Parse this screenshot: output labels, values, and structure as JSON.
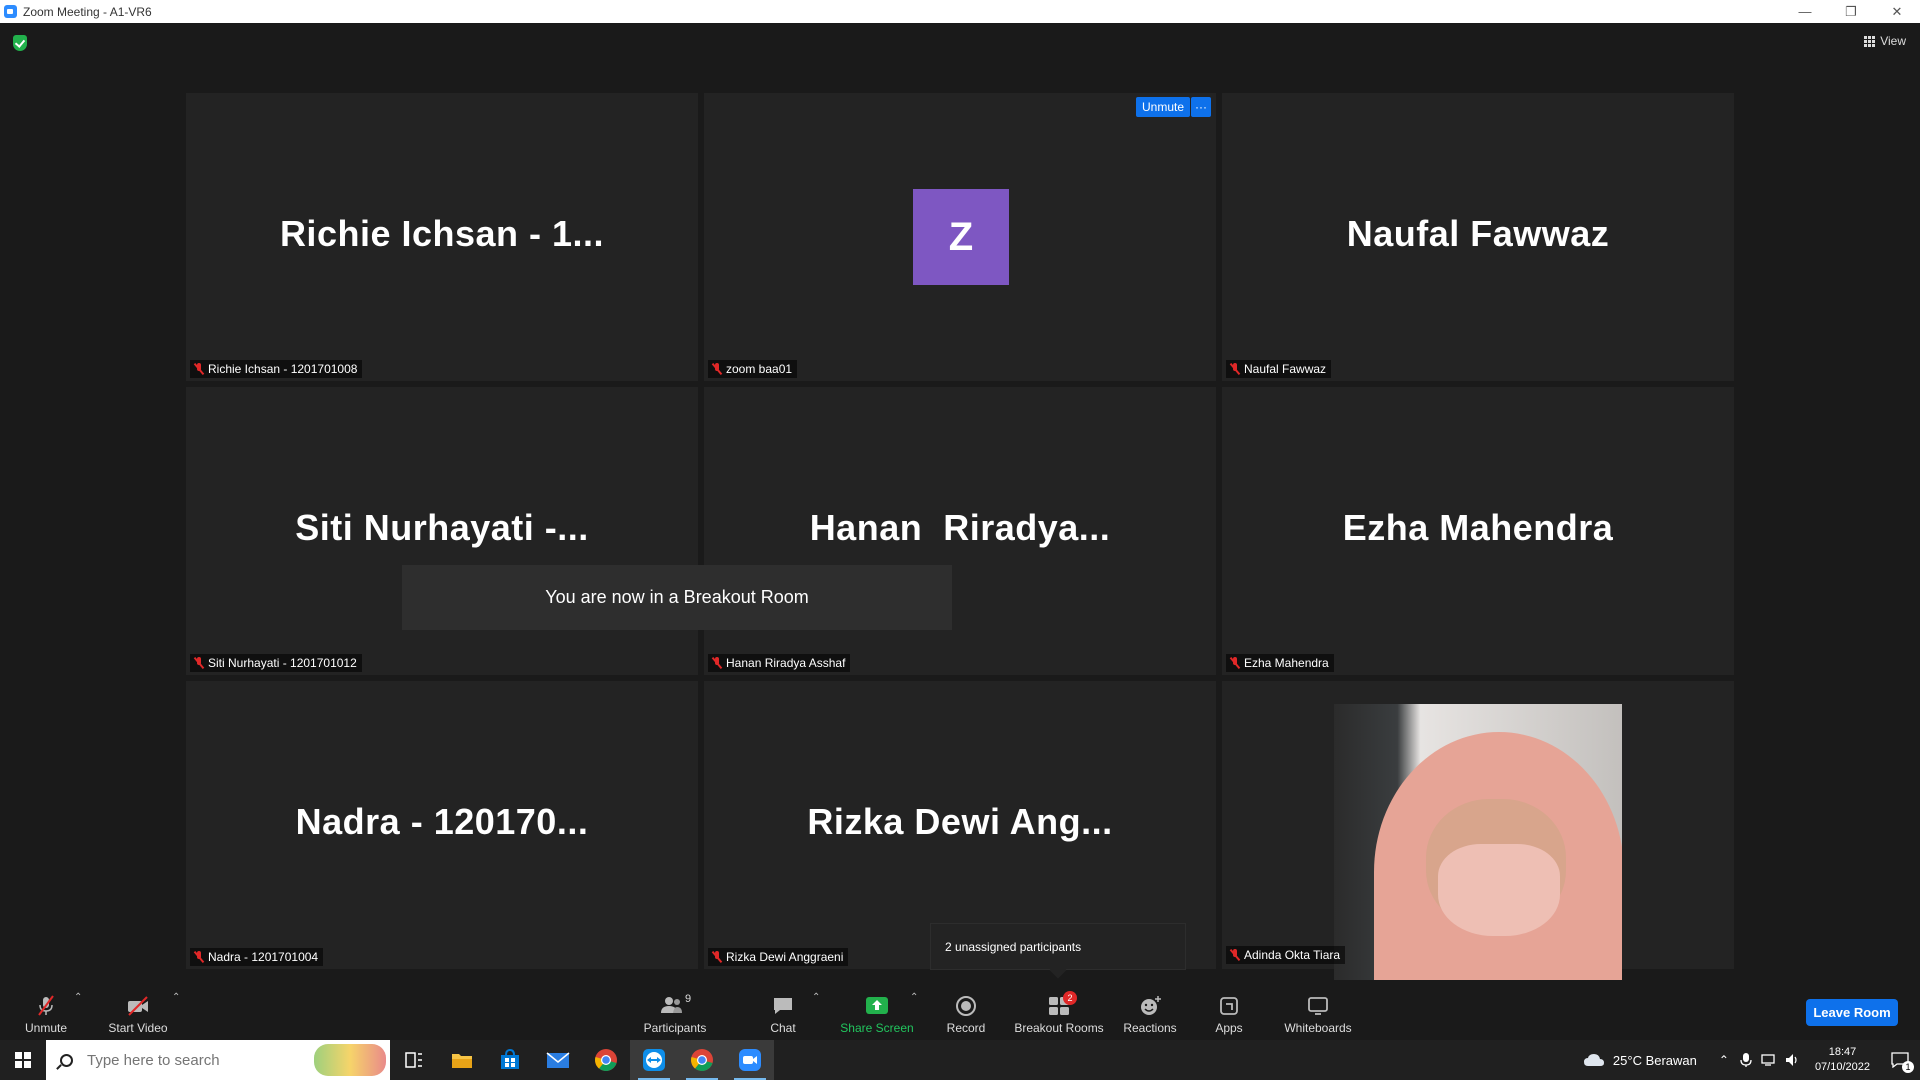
{
  "window": {
    "title": "Zoom Meeting - A1-VR6"
  },
  "top_bar": {
    "view_label": "View"
  },
  "tiles": [
    {
      "display_name": "Richie Ichsan - 1...",
      "label": "Richie Ichsan - 1201701008"
    },
    {
      "avatar_letter": "Z",
      "label": "zoom baa01",
      "unmute_chip": "Unmute",
      "more_chip": "···"
    },
    {
      "display_name": "Naufal Fawwaz",
      "label": "Naufal Fawwaz"
    },
    {
      "display_name": "Siti Nurhayati -...",
      "label": "Siti Nurhayati - 1201701012"
    },
    {
      "display_name": "Hanan  Riradya...",
      "label": "Hanan Riradya Asshaf"
    },
    {
      "display_name": "Ezha Mahendra",
      "label": "Ezha Mahendra"
    },
    {
      "display_name": "Nadra - 120170...",
      "label": "Nadra - 1201701004"
    },
    {
      "display_name": "Rizka Dewi Ang...",
      "label": "Rizka Dewi Anggraeni"
    },
    {
      "label": "Adinda Okta Tiara"
    }
  ],
  "toast": {
    "message": "You are now in a Breakout Room"
  },
  "breakout_hint": {
    "text": "2 unassigned participants"
  },
  "toolbar": {
    "unmute": "Unmute",
    "start_video": "Start Video",
    "participants": "Participants",
    "participants_count": "9",
    "chat": "Chat",
    "share_screen": "Share Screen",
    "record": "Record",
    "breakout_rooms": "Breakout Rooms",
    "breakout_badge": "2",
    "reactions": "Reactions",
    "apps": "Apps",
    "whiteboards": "Whiteboards",
    "leave": "Leave Room"
  },
  "taskbar": {
    "search_placeholder": "Type here to search",
    "weather": "25°C  Berawan",
    "time": "18:47",
    "date": "07/10/2022",
    "notification_count": "1"
  },
  "colors": {
    "accent_blue": "#0e71eb",
    "share_green": "#22b14c",
    "mute_red": "#e02828",
    "avatar_purple": "#7e57c2"
  }
}
